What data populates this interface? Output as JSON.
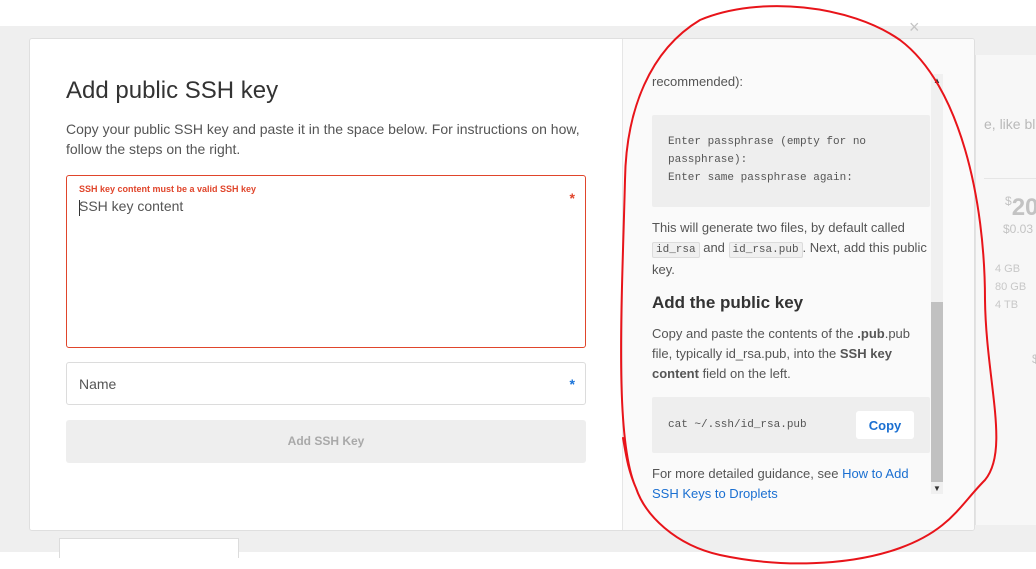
{
  "background": {
    "snippet_text": "e, like blo",
    "price_currency": "$",
    "price_amount": "20",
    "price_sub": "$0.03",
    "specs": [
      "4 GB",
      "80 GB",
      "4 TB"
    ]
  },
  "modal": {
    "title": "Add public SSH key",
    "description": "Copy your public SSH key and paste it in the space below. For instructions on how, follow the steps on the right.",
    "key_field": {
      "error": "SSH key content must be a valid SSH key",
      "placeholder": "SSH key content",
      "required_mark": "*"
    },
    "name_field": {
      "placeholder": "Name",
      "required_mark": "*"
    },
    "submit_label": "Add SSH Key",
    "close_glyph": "×"
  },
  "guide": {
    "recommended_text": "recommended):",
    "passphrase_lines": [
      "Enter passphrase (empty for no",
      "passphrase):",
      "Enter same passphrase again:"
    ],
    "generate_para": {
      "part1": "This will generate two files, by default called ",
      "file1": "id_rsa",
      "part2": " and ",
      "file2": "id_rsa.pub",
      "part3": ". Next, add this public key."
    },
    "add_key_heading": "Add the public key",
    "copy_para": {
      "part1": "Copy and paste the contents of the ",
      "bold_ext": ".pub",
      "part2": ".pub file, typically id_rsa.pub, into the ",
      "bold_field": "SSH key content",
      "part3": " field on the left."
    },
    "command": "cat ~/.ssh/id_rsa.pub",
    "copy_label": "Copy",
    "more_text": "For more detailed guidance, see ",
    "more_link": "How to Add SSH Keys to Droplets"
  },
  "colors": {
    "error": "#e0452b",
    "link": "#1a6fd1",
    "annotation": "#e8141a"
  }
}
